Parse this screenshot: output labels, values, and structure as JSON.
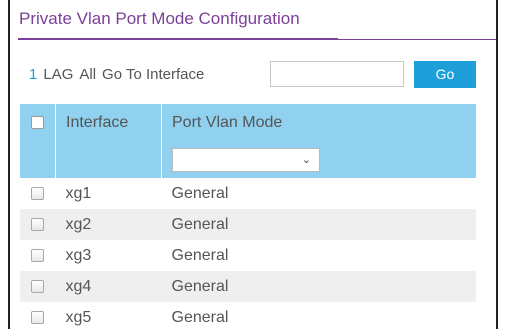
{
  "page": {
    "title": "Private Vlan Port Mode Configuration"
  },
  "nav": {
    "page_number": "1",
    "lag_label": "LAG",
    "all_label": "All",
    "goto_label": "Go To Interface",
    "goto_value": "",
    "go_button": "Go"
  },
  "table": {
    "headers": {
      "interface": "Interface",
      "port_vlan_mode": "Port Vlan Mode"
    },
    "filter": {
      "mode_selected": ""
    },
    "rows": [
      {
        "interface": "xg1",
        "mode": "General"
      },
      {
        "interface": "xg2",
        "mode": "General"
      },
      {
        "interface": "xg3",
        "mode": "General"
      },
      {
        "interface": "xg4",
        "mode": "General"
      },
      {
        "interface": "xg5",
        "mode": "General"
      }
    ]
  },
  "colors": {
    "title": "#7b3f99",
    "header_bg": "#8fd1ee",
    "go_button_bg": "#1e9fd9",
    "link": "#1aa0d8"
  }
}
